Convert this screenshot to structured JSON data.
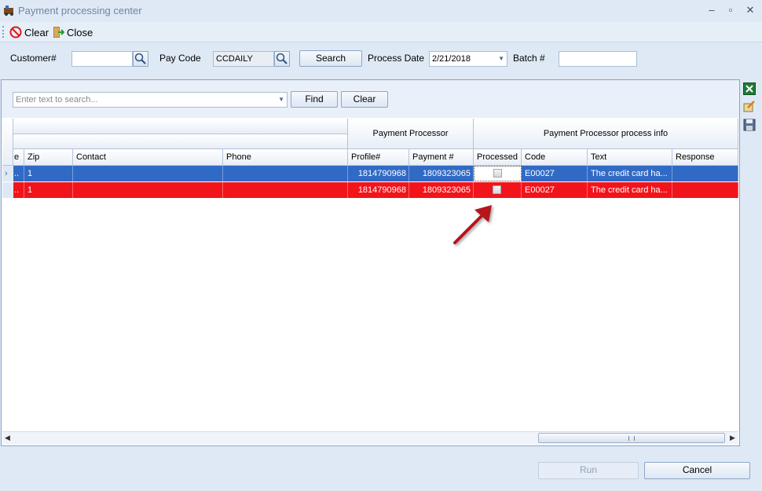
{
  "window": {
    "title": "Payment processing center"
  },
  "toolbar": {
    "clear_label": "Clear",
    "close_label": "Close"
  },
  "filters": {
    "customer_label": "Customer#",
    "customer_value": "",
    "paycode_label": "Pay Code",
    "paycode_value": "CCDAILY",
    "search_label": "Search",
    "process_date_label": "Process Date",
    "process_date_value": "2/21/2018",
    "batch_label": "Batch #",
    "batch_value": ""
  },
  "findbar": {
    "placeholder": "Enter text to search...",
    "find_label": "Find",
    "clear_label": "Clear"
  },
  "grid": {
    "bands": {
      "processor": "Payment Processor",
      "processor_info": "Payment Processor process info"
    },
    "columns": {
      "e": "e",
      "zip": "Zip",
      "contact": "Contact",
      "phone": "Phone",
      "profile": "Profile#",
      "payment": "Payment #",
      "processed": "Processed",
      "code": "Code",
      "text": "Text",
      "response": "Response"
    },
    "rows": [
      {
        "e": "..",
        "zip": "1",
        "contact": "",
        "phone": "",
        "profile": "1814790968",
        "payment": "1809323065",
        "processed": false,
        "code": "E00027",
        "text": "The credit card ha...",
        "response": ""
      },
      {
        "e": "..",
        "zip": "1",
        "contact": "",
        "phone": "",
        "profile": "1814790968",
        "payment": "1809323065",
        "processed": false,
        "code": "E00027",
        "text": "The credit card ha...",
        "response": ""
      }
    ]
  },
  "footer": {
    "run_label": "Run",
    "cancel_label": "Cancel"
  },
  "colors": {
    "selected_row": "#316ac5",
    "error_row": "#f2141b",
    "annotation_arrow": "#b5121b"
  }
}
